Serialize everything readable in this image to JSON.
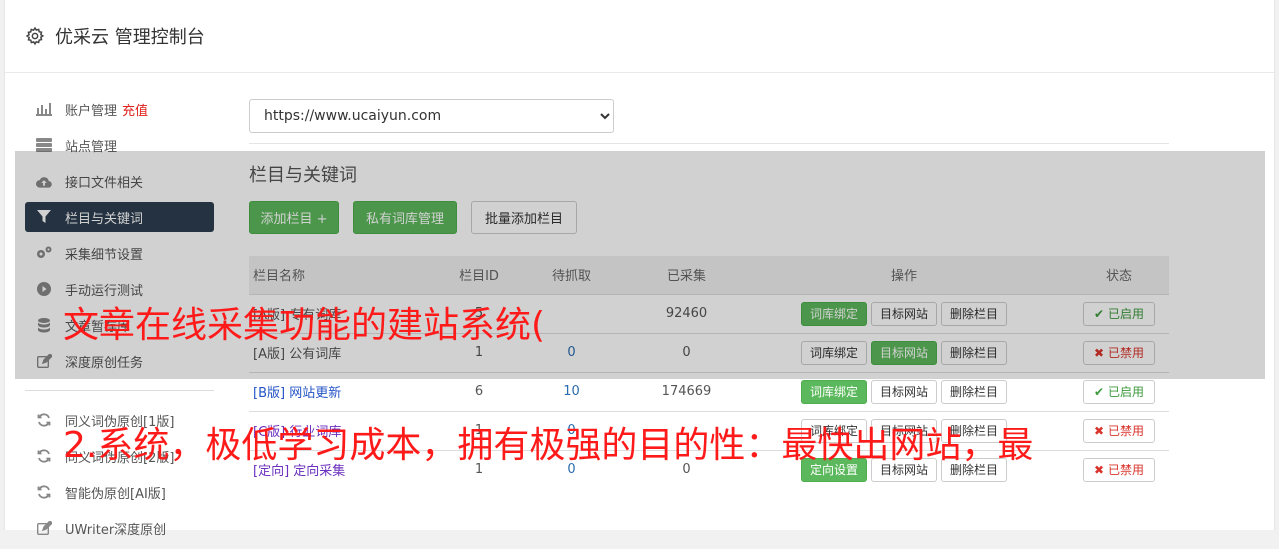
{
  "header": {
    "title": "优采云 管理控制台",
    "icon": "gear-icon"
  },
  "sidebar": {
    "items": [
      {
        "label": "账户管理",
        "extra": "充值",
        "icon": "bar-chart-icon"
      },
      {
        "label": "站点管理",
        "icon": "server-icon"
      },
      {
        "label": "接口文件相关",
        "icon": "cloud-upload-icon"
      },
      {
        "label": "栏目与关键词",
        "icon": "filter-icon",
        "active": true
      },
      {
        "label": "采集细节设置",
        "icon": "cogs-icon"
      },
      {
        "label": "手动运行测试",
        "icon": "play-circle-icon"
      },
      {
        "label": "文章暂存库",
        "icon": "database-icon"
      },
      {
        "label": "深度原创任务",
        "icon": "edit-icon"
      }
    ],
    "items2": [
      {
        "label": "同义词伪原创[1版]",
        "icon": "refresh-icon"
      },
      {
        "label": "同义词伪原创[2版]",
        "icon": "refresh-icon"
      },
      {
        "label": "智能伪原创[AI版]",
        "icon": "refresh-icon"
      },
      {
        "label": "UWriter深度原创",
        "icon": "edit-icon"
      }
    ]
  },
  "main": {
    "site_select": "https://www.ucaiyun.com",
    "section_title": "栏目与关键词",
    "buttons": {
      "add": "添加栏目 +",
      "private": "私有词库管理",
      "batch": "批量添加栏目"
    },
    "table": {
      "headers": [
        "栏目名称",
        "栏目ID",
        "待抓取",
        "已采集",
        "操作",
        "状态"
      ],
      "rows": [
        {
          "tag": "[A版]",
          "name": "专有词库",
          "id": "5",
          "wait": "",
          "done": "92460",
          "op1": "词库绑定",
          "op2": "目标网站",
          "op3": "删除栏目",
          "status": "已启用"
        },
        {
          "tag": "[A版]",
          "name": "公有词库",
          "id": "1",
          "wait": "0",
          "done": "0",
          "op1": "词库绑定",
          "op2": "目标网站",
          "op3": "删除栏目",
          "status": "已禁用"
        },
        {
          "tag": "[B版]",
          "name": "网站更新",
          "id": "6",
          "wait": "10",
          "done": "174669",
          "op1": "词库绑定",
          "op2": "目标网站",
          "op3": "删除栏目",
          "status": "已启用"
        },
        {
          "tag": "[C版]",
          "name": "行业词库",
          "id": "1",
          "wait": "0",
          "done": "",
          "op1": "词库绑定",
          "op2": "目标网站",
          "op3": "删除栏目",
          "status": "已禁用"
        },
        {
          "tag": "[定向]",
          "name": "定向采集",
          "id": "1",
          "wait": "0",
          "done": "0",
          "op1": "定向设置",
          "op2": "目标网站",
          "op3": "删除栏目",
          "status": "已禁用"
        }
      ]
    }
  },
  "watermark": {
    "line1": "文章在线采集功能的建站系统(",
    "line2": "2.系统，极低学习成本，拥有极强的目的性：最快出网站，最"
  }
}
